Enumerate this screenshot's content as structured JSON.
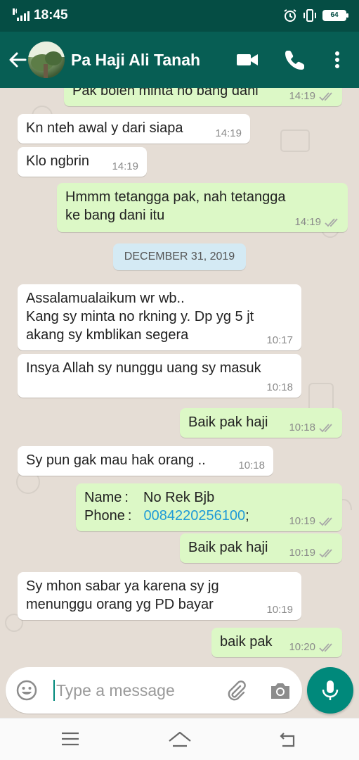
{
  "status_bar": {
    "signal_label": "H",
    "time": "18:45",
    "battery": "64",
    "icons": [
      "signal-icon",
      "alarm-icon",
      "vibrate-icon",
      "battery-icon"
    ]
  },
  "header": {
    "contact_name": "Pa Haji Ali Tanah",
    "icons": [
      "back-arrow-icon",
      "avatar",
      "video-call-icon",
      "voice-call-icon",
      "more-vert-icon"
    ]
  },
  "chat": {
    "date_divider": "DECEMBER 31, 2019",
    "messages": [
      {
        "direction": "out",
        "text": "Pak boleh minta no bang dani",
        "time": "14:19",
        "status": "read"
      },
      {
        "direction": "in",
        "text": "Kn nteh awal y dari siapa",
        "time": "14:19"
      },
      {
        "direction": "in",
        "text": "Klo ngbrin",
        "time": "14:19"
      },
      {
        "direction": "out",
        "text": "Hmmm tetangga pak, nah tetangga\nke bang dani itu",
        "time": "14:19",
        "status": "read"
      },
      {
        "direction": "in",
        "text": "Assalamualaikum wr wb..\nKang sy minta no rkning y. Dp yg 5 jt\nakang sy kmblikan segera",
        "time": "10:17"
      },
      {
        "direction": "in",
        "text": "Insya Allah sy nunggu uang sy masuk",
        "time": "10:18"
      },
      {
        "direction": "out",
        "text": "Baik pak haji",
        "time": "10:18",
        "status": "read"
      },
      {
        "direction": "in",
        "text": "Sy pun gak mau hak orang ..",
        "time": "10:18"
      },
      {
        "direction": "out",
        "type": "contact",
        "name_label": "Name :",
        "name_value": "No Rek Bjb",
        "phone_label": "Phone :",
        "phone_value": "0084220256100",
        "phone_suffix": ";",
        "time": "10:19",
        "status": "read"
      },
      {
        "direction": "out",
        "text": "Baik pak haji",
        "time": "10:19",
        "status": "read"
      },
      {
        "direction": "in",
        "text": "Sy mhon sabar ya karena sy jg\nmenunggu orang yg PD bayar",
        "time": "10:19"
      },
      {
        "direction": "out",
        "text": "baik pak",
        "time": "10:20",
        "status": "read"
      }
    ]
  },
  "input": {
    "placeholder": "Type a message",
    "icons": [
      "emoji-icon",
      "attach-icon",
      "camera-icon",
      "mic-icon"
    ]
  },
  "nav": {
    "icons": [
      "menu-icon",
      "home-icon",
      "back-icon"
    ]
  },
  "colors": {
    "status_bar": "#054d44",
    "header": "#075e54",
    "chat_bg": "#e5ddd5",
    "outgoing_bubble": "#dcf8c6",
    "incoming_bubble": "#ffffff",
    "accent": "#00897b",
    "link": "#1f9bd7"
  }
}
